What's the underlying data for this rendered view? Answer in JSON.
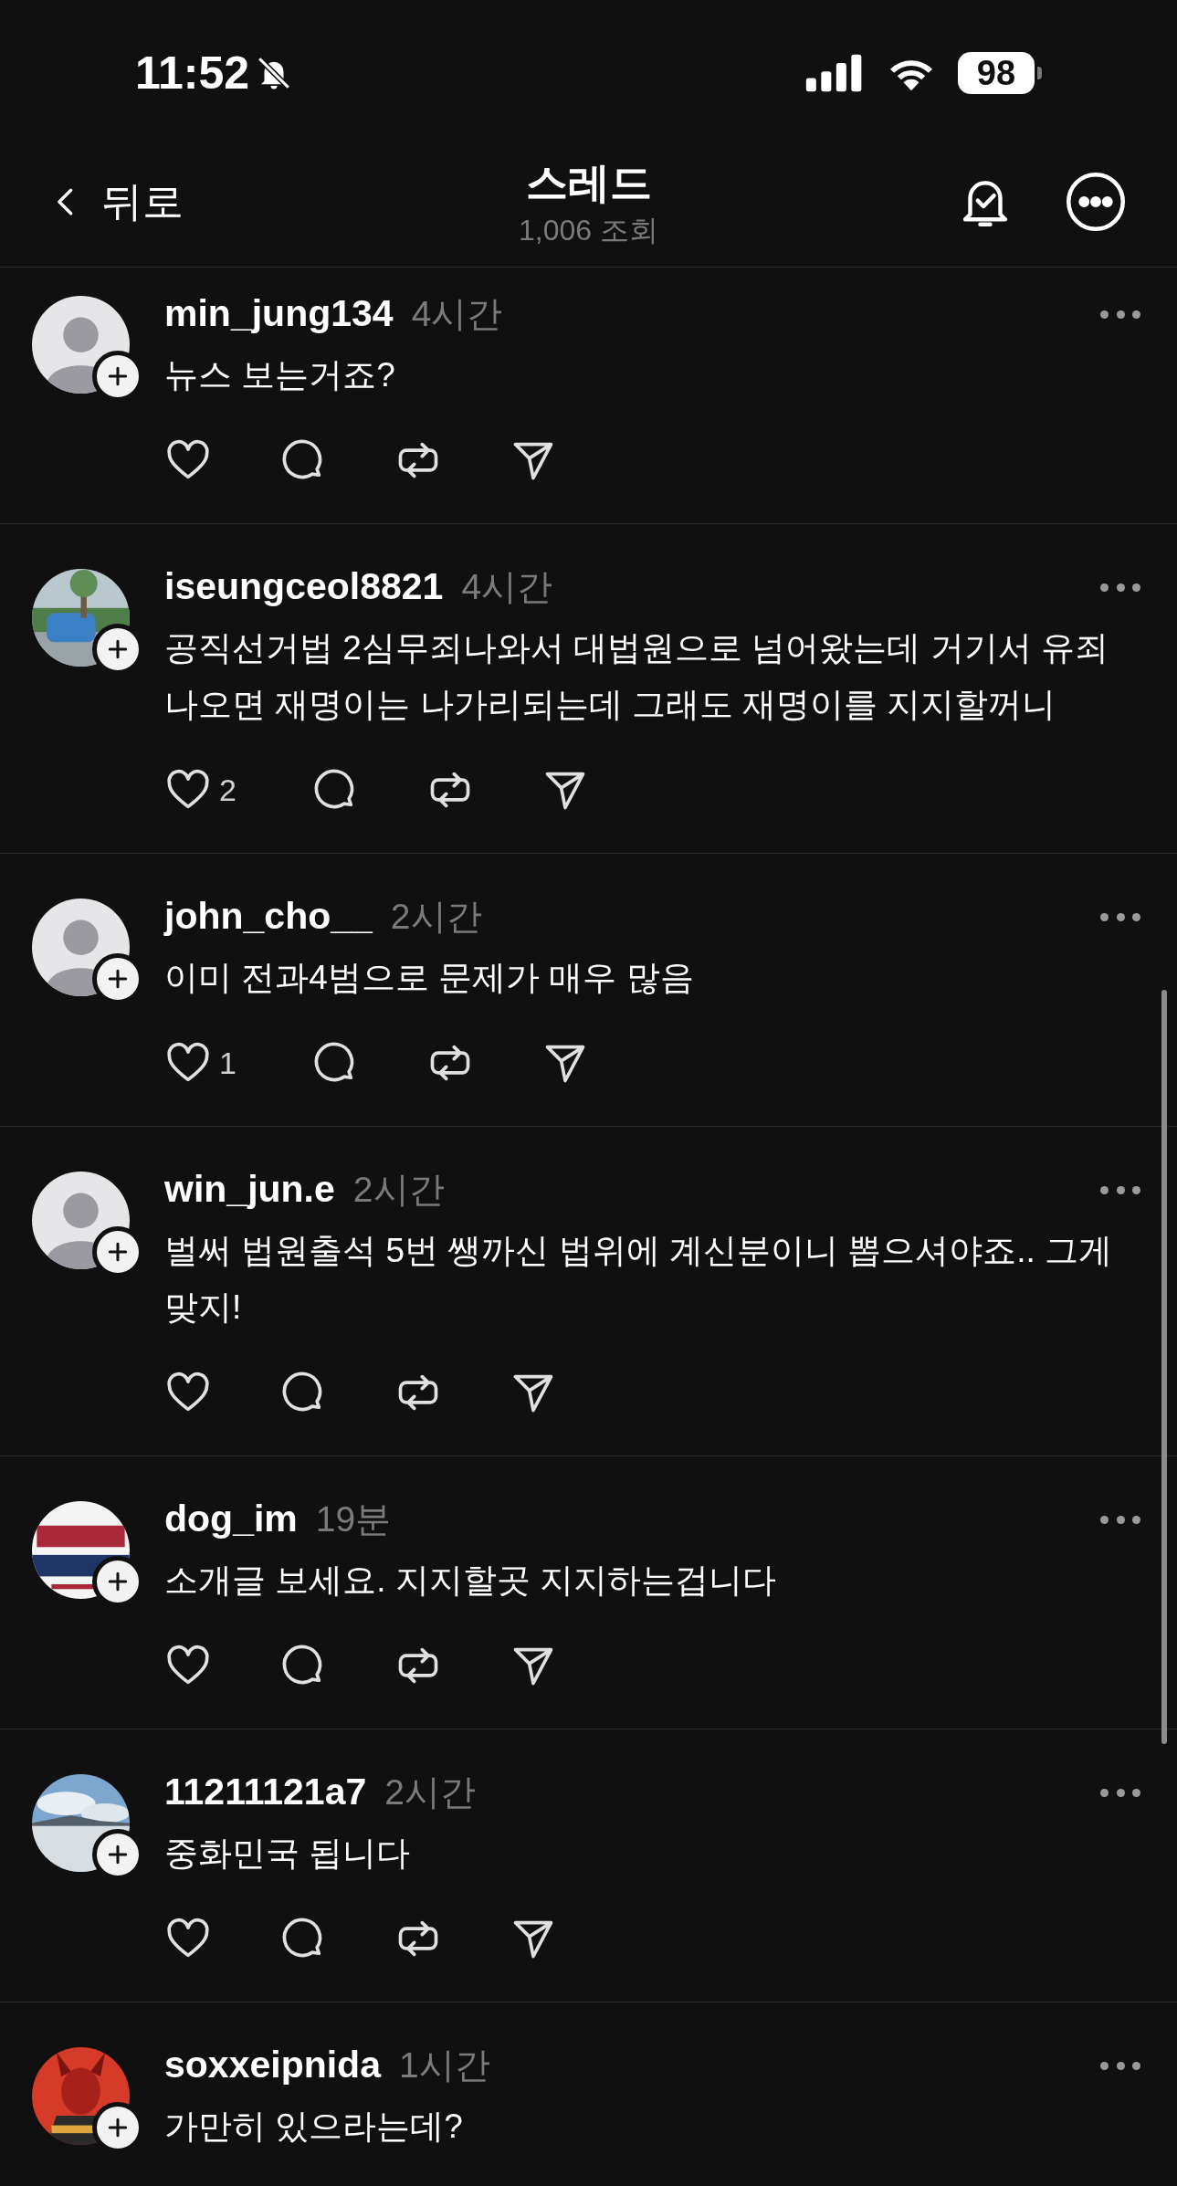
{
  "status_bar": {
    "time": "11:52",
    "battery": "98"
  },
  "nav": {
    "back": "뒤로",
    "title": "스레드",
    "views": "1,006 조회"
  },
  "posts": [
    {
      "username": "min_jung134",
      "time": "4시간",
      "text": "뉴스 보는거죠?",
      "avatar": {
        "kind": "default"
      }
    },
    {
      "username": "iseungceol8821",
      "time": "4시간",
      "text": "공직선거법 2심무죄나와서 대법원으로 넘어왔는데 거기서 유죄나오면 재명이는 나가리되는데 그래도 재명이를 지지할꺼니",
      "likes": "2"
    },
    {
      "username": "john_cho__",
      "time": "2시간",
      "text": "이미 전과4범으로 문제가 매우 많음",
      "likes": "1",
      "avatar": {
        "kind": "default"
      }
    },
    {
      "username": "win_jun.e",
      "time": "2시간",
      "text": "벌써 법원출석 5번 쌩까신 법위에 계신분이니 뽑으셔야죠.. 그게맞지!",
      "avatar": {
        "kind": "default"
      }
    },
    {
      "username": "dog_im",
      "time": "19분",
      "text": "소개글 보세요. 지지할곳 지지하는겁니다"
    },
    {
      "username": "11211121a7",
      "time": "2시간",
      "text": "중화민국 됩니다"
    },
    {
      "username": "soxxeipnida",
      "time": "1시간",
      "text": "가만히 있으라는데?"
    }
  ]
}
